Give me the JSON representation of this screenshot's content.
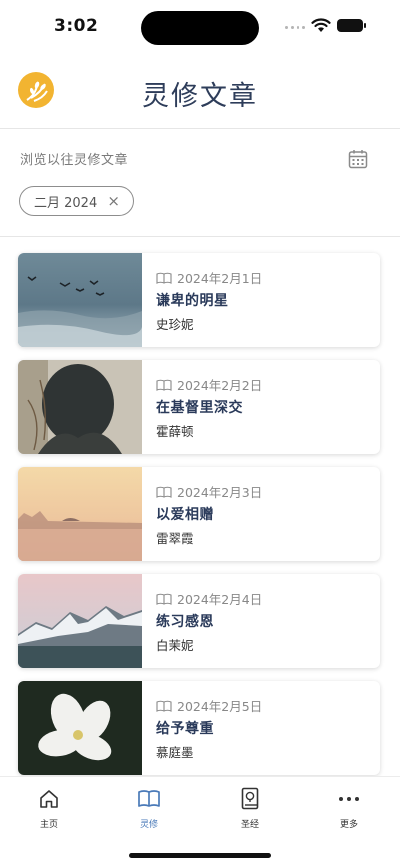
{
  "status_bar": {
    "time": "3:02"
  },
  "header": {
    "title": "灵修文章"
  },
  "browse": {
    "label": "浏览以往灵修文章"
  },
  "filter": {
    "chip_label": "二月 2024",
    "clear_symbol": "×"
  },
  "articles": [
    {
      "date": "2024年2月1日",
      "title": "谦卑的明星",
      "author": "史珍妮"
    },
    {
      "date": "2024年2月2日",
      "title": "在基督里深交",
      "author": "霍薛顿"
    },
    {
      "date": "2024年2月3日",
      "title": "以爱相赠",
      "author": "雷翠霞"
    },
    {
      "date": "2024年2月4日",
      "title": "练习感恩",
      "author": "白茉妮"
    },
    {
      "date": "2024年2月5日",
      "title": "给予尊重",
      "author": "慕庭墨"
    }
  ],
  "tabs": [
    {
      "label": "主页",
      "icon": "home-icon"
    },
    {
      "label": "灵修",
      "icon": "open-book-icon"
    },
    {
      "label": "圣经",
      "icon": "bible-icon"
    },
    {
      "label": "更多",
      "icon": "more-dots-icon"
    }
  ],
  "colors": {
    "accent": "#4a7ab8",
    "title": "#2e3d5a",
    "logo": "#f2b431"
  }
}
